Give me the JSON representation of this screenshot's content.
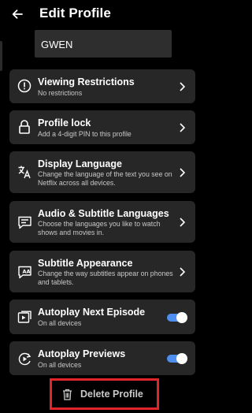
{
  "header": {
    "title": "Edit Profile"
  },
  "profile": {
    "name": "GWEN"
  },
  "settings": [
    {
      "label": "Viewing Restrictions",
      "sub": "No restrictions",
      "icon": "warning-circle-icon",
      "control": "chevron"
    },
    {
      "label": "Profile lock",
      "sub": "Add a 4-digit PIN to this profile",
      "icon": "lock-icon",
      "control": "chevron"
    },
    {
      "label": "Display Language",
      "sub": "Change the language of the text you see on Netflix across all devices.",
      "icon": "translate-icon",
      "control": "chevron"
    },
    {
      "label": "Audio & Subtitle Languages",
      "sub": "Choose the languages you like to watch shows and movies in.",
      "icon": "subtitles-icon",
      "control": "chevron"
    },
    {
      "label": "Subtitle Appearance",
      "sub": "Change the way subtitles appear on phones and tablets.",
      "icon": "subtitle-appearance-icon",
      "control": "chevron"
    },
    {
      "label": "Autoplay Next Episode",
      "sub": "On all devices",
      "icon": "autoplay-next-icon",
      "control": "toggle",
      "on": true
    },
    {
      "label": "Autoplay Previews",
      "sub": "On all devices",
      "icon": "autoplay-previews-icon",
      "control": "toggle",
      "on": true
    }
  ],
  "delete": {
    "label": "Delete Profile",
    "icon": "trash-icon"
  },
  "colors": {
    "toggle_on": "#4e8ef0",
    "highlight_box": "#e3242b",
    "card_bg": "#272727",
    "background": "#000000"
  }
}
